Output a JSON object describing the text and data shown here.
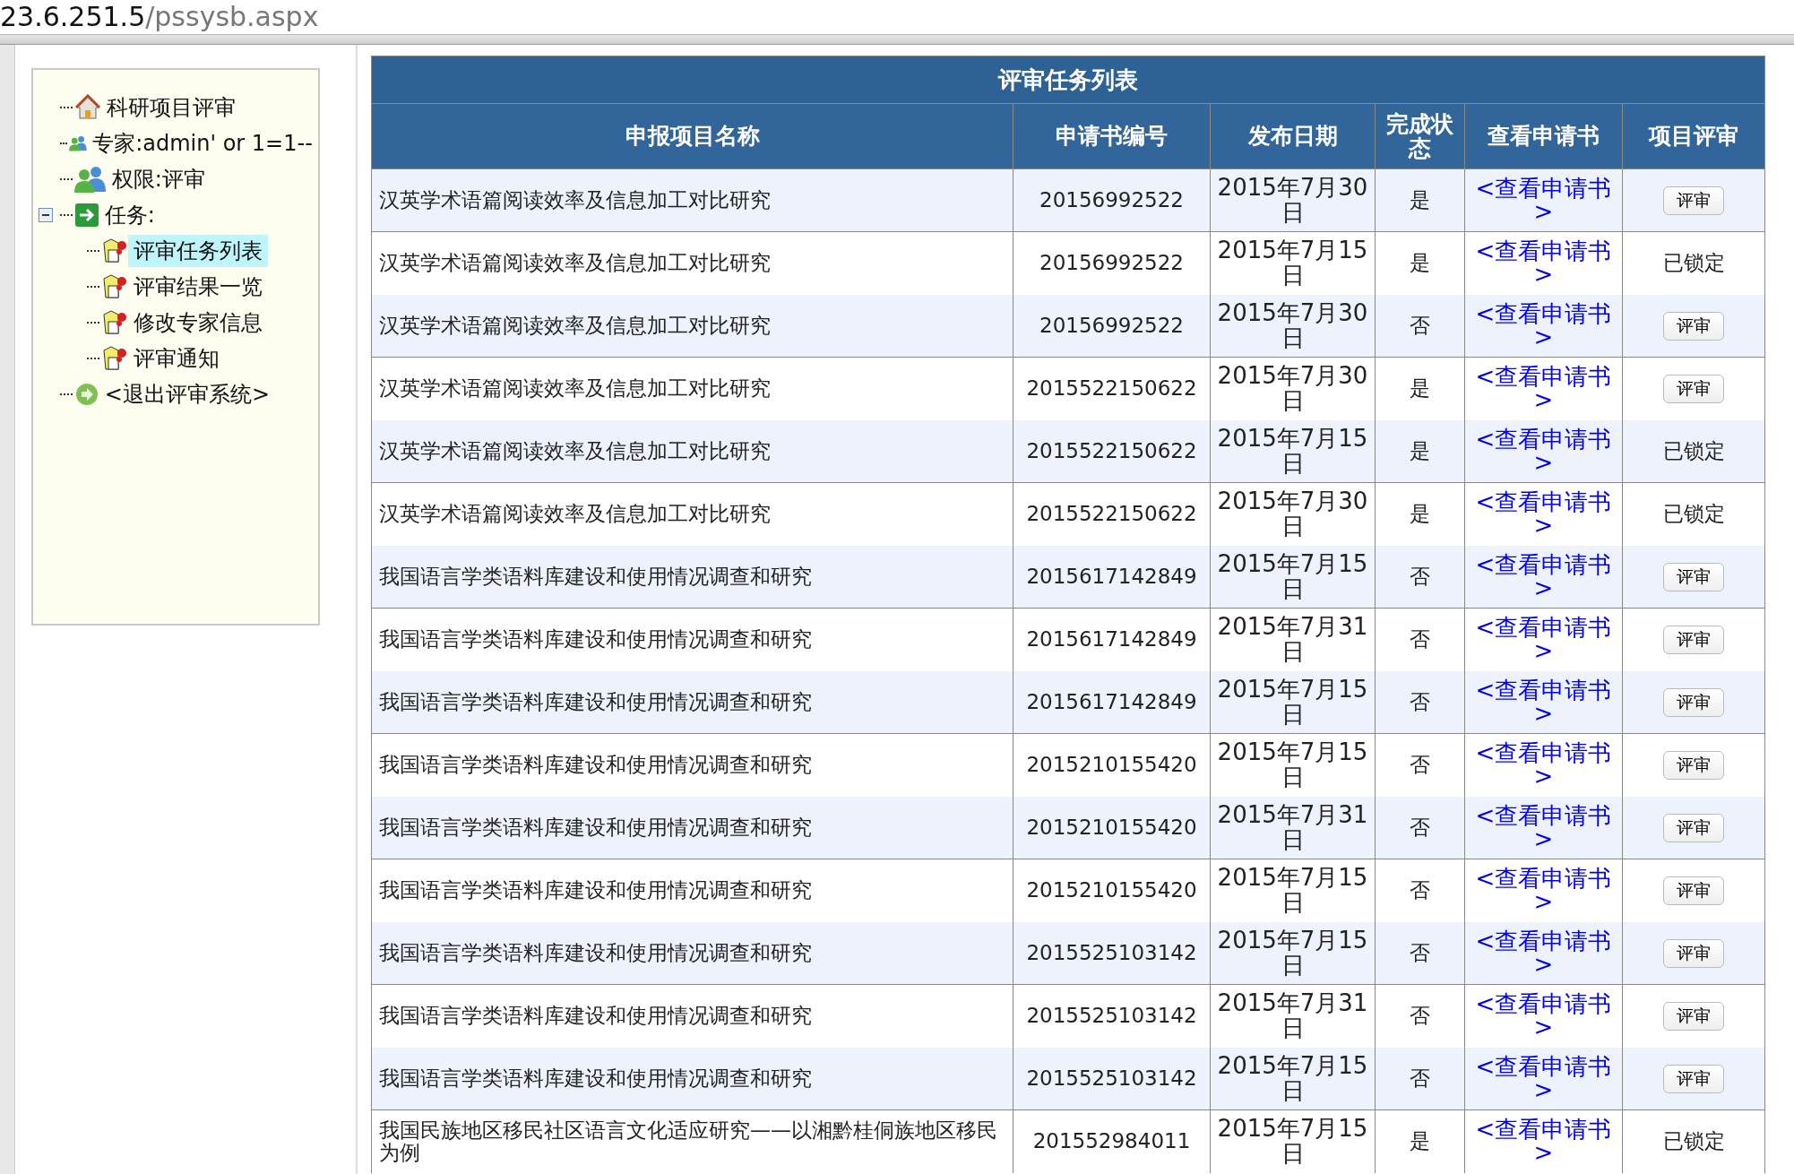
{
  "address_bar": {
    "host": "23.6.251.5",
    "path": "/pssysb.aspx"
  },
  "sidebar": {
    "items": [
      {
        "label": "科研项目评审",
        "kind": "home",
        "selected": false
      },
      {
        "label": "专家:admin' or 1=1--",
        "kind": "users",
        "selected": false
      },
      {
        "label": "权限:评审",
        "kind": "users",
        "selected": false
      },
      {
        "label": "任务:",
        "kind": "arrow",
        "selected": false,
        "expanded": true,
        "children": [
          {
            "label": "评审任务列表",
            "kind": "task",
            "selected": true
          },
          {
            "label": "评审结果一览",
            "kind": "task",
            "selected": false
          },
          {
            "label": "修改专家信息",
            "kind": "task",
            "selected": false
          },
          {
            "label": "评审通知",
            "kind": "task",
            "selected": false
          }
        ]
      },
      {
        "label": "<退出评审系统>",
        "kind": "exit",
        "selected": false
      }
    ]
  },
  "table": {
    "title": "评审任务列表",
    "columns": [
      "申报项目名称",
      "申请书编号",
      "发布日期",
      "完成状态",
      "查看申请书",
      "项目评审"
    ],
    "rows": [
      {
        "name": "汉英学术语篇阅读效率及信息加工对比研究",
        "number": "20156992522",
        "date": "2015年7月30日",
        "done": "是",
        "link": "<查看申请书>",
        "action": {
          "kind": "button",
          "label": "评审"
        }
      },
      {
        "name": "汉英学术语篇阅读效率及信息加工对比研究",
        "number": "20156992522",
        "date": "2015年7月15日",
        "done": "是",
        "link": "<查看申请书>",
        "action": {
          "kind": "text",
          "label": "已锁定"
        }
      },
      {
        "name": "汉英学术语篇阅读效率及信息加工对比研究",
        "number": "20156992522",
        "date": "2015年7月30日",
        "done": "否",
        "link": "<查看申请书>",
        "action": {
          "kind": "button",
          "label": "评审"
        }
      },
      {
        "name": "汉英学术语篇阅读效率及信息加工对比研究",
        "number": "2015522150622",
        "date": "2015年7月30日",
        "done": "是",
        "link": "<查看申请书>",
        "action": {
          "kind": "button",
          "label": "评审"
        }
      },
      {
        "name": "汉英学术语篇阅读效率及信息加工对比研究",
        "number": "2015522150622",
        "date": "2015年7月15日",
        "done": "是",
        "link": "<查看申请书>",
        "action": {
          "kind": "text",
          "label": "已锁定"
        }
      },
      {
        "name": "汉英学术语篇阅读效率及信息加工对比研究",
        "number": "2015522150622",
        "date": "2015年7月30日",
        "done": "是",
        "link": "<查看申请书>",
        "action": {
          "kind": "text",
          "label": "已锁定"
        }
      },
      {
        "name": "我国语言学类语料库建设和使用情况调查和研究",
        "number": "2015617142849",
        "date": "2015年7月15日",
        "done": "否",
        "link": "<查看申请书>",
        "action": {
          "kind": "button",
          "label": "评审"
        }
      },
      {
        "name": "我国语言学类语料库建设和使用情况调查和研究",
        "number": "2015617142849",
        "date": "2015年7月31日",
        "done": "否",
        "link": "<查看申请书>",
        "action": {
          "kind": "button",
          "label": "评审"
        }
      },
      {
        "name": "我国语言学类语料库建设和使用情况调查和研究",
        "number": "2015617142849",
        "date": "2015年7月15日",
        "done": "否",
        "link": "<查看申请书>",
        "action": {
          "kind": "button",
          "label": "评审"
        }
      },
      {
        "name": "我国语言学类语料库建设和使用情况调查和研究",
        "number": "2015210155420",
        "date": "2015年7月15日",
        "done": "否",
        "link": "<查看申请书>",
        "action": {
          "kind": "button",
          "label": "评审"
        }
      },
      {
        "name": "我国语言学类语料库建设和使用情况调查和研究",
        "number": "2015210155420",
        "date": "2015年7月31日",
        "done": "否",
        "link": "<查看申请书>",
        "action": {
          "kind": "button",
          "label": "评审"
        }
      },
      {
        "name": "我国语言学类语料库建设和使用情况调查和研究",
        "number": "2015210155420",
        "date": "2015年7月15日",
        "done": "否",
        "link": "<查看申请书>",
        "action": {
          "kind": "button",
          "label": "评审"
        }
      },
      {
        "name": "我国语言学类语料库建设和使用情况调查和研究",
        "number": "2015525103142",
        "date": "2015年7月15日",
        "done": "否",
        "link": "<查看申请书>",
        "action": {
          "kind": "button",
          "label": "评审"
        }
      },
      {
        "name": "我国语言学类语料库建设和使用情况调查和研究",
        "number": "2015525103142",
        "date": "2015年7月31日",
        "done": "否",
        "link": "<查看申请书>",
        "action": {
          "kind": "button",
          "label": "评审"
        }
      },
      {
        "name": "我国语言学类语料库建设和使用情况调查和研究",
        "number": "2015525103142",
        "date": "2015年7月15日",
        "done": "否",
        "link": "<查看申请书>",
        "action": {
          "kind": "button",
          "label": "评审"
        }
      },
      {
        "name": "我国民族地区移民社区语言文化适应研究——以湘黔桂侗族地区移民为例",
        "number": "201552984011",
        "date": "2015年7月15日",
        "done": "是",
        "link": "<查看申请书>",
        "action": {
          "kind": "text",
          "label": "已锁定"
        }
      }
    ]
  }
}
